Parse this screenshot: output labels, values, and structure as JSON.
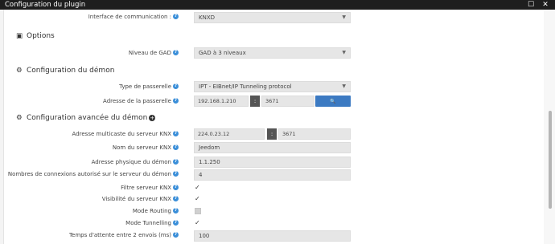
{
  "window": {
    "title": "Configuration du plugin",
    "maximize_glyph": "☐",
    "close_glyph": "✕"
  },
  "rows": {
    "interface": {
      "label": "Interface de communication :",
      "value": "KNXD"
    },
    "niveau_gad": {
      "label": "Niveau de GAD",
      "value": "GAD à 3 niveaux"
    },
    "type_passerelle": {
      "label": "Type de passerelle",
      "value": "IPT - EIBnet/IP Tunneling protocol"
    },
    "adresse_passerelle": {
      "label": "Adresse de la passerelle",
      "ip": "192.168.1.210",
      "port": "3671",
      "button": "Rechercher"
    },
    "multicast": {
      "label": "Adresse multicaste du serveur KNX",
      "ip": "224.0.23.12",
      "port": "3671"
    },
    "nom_serveur": {
      "label": "Nom du serveur KNX",
      "value": "Jeedom"
    },
    "adresse_physique": {
      "label": "Adresse physique du démon",
      "value": "1.1.250"
    },
    "nb_connexions": {
      "label": "Nombres de connexions autorisé sur le serveur du démon",
      "value": "4"
    },
    "filtre": {
      "label": "Filtre serveur KNX",
      "checked": true
    },
    "visibilite": {
      "label": "Visibilité du serveur KNX",
      "checked": true
    },
    "routing": {
      "label": "Mode Routing",
      "checked": false
    },
    "tunnelling": {
      "label": "Mode Tunnelling",
      "checked": true
    },
    "temps_attente": {
      "label": "Temps d'attente entre 2 envois (ms)",
      "value": "100"
    }
  },
  "sections": {
    "options": "Options",
    "config_demon": "Configuration du démon",
    "config_avancee": "Configuration avancée du démon"
  },
  "glyphs": {
    "colon": ":",
    "help": "?",
    "check": "✓",
    "arrow": "▼",
    "search": "🔍",
    "plus": "+",
    "id_card": "▣",
    "gear": "⚙"
  },
  "colors": {
    "accent": "#3c7ac2",
    "help_icon": "#3b8fd9",
    "titlebar": "#1e1e1e"
  }
}
